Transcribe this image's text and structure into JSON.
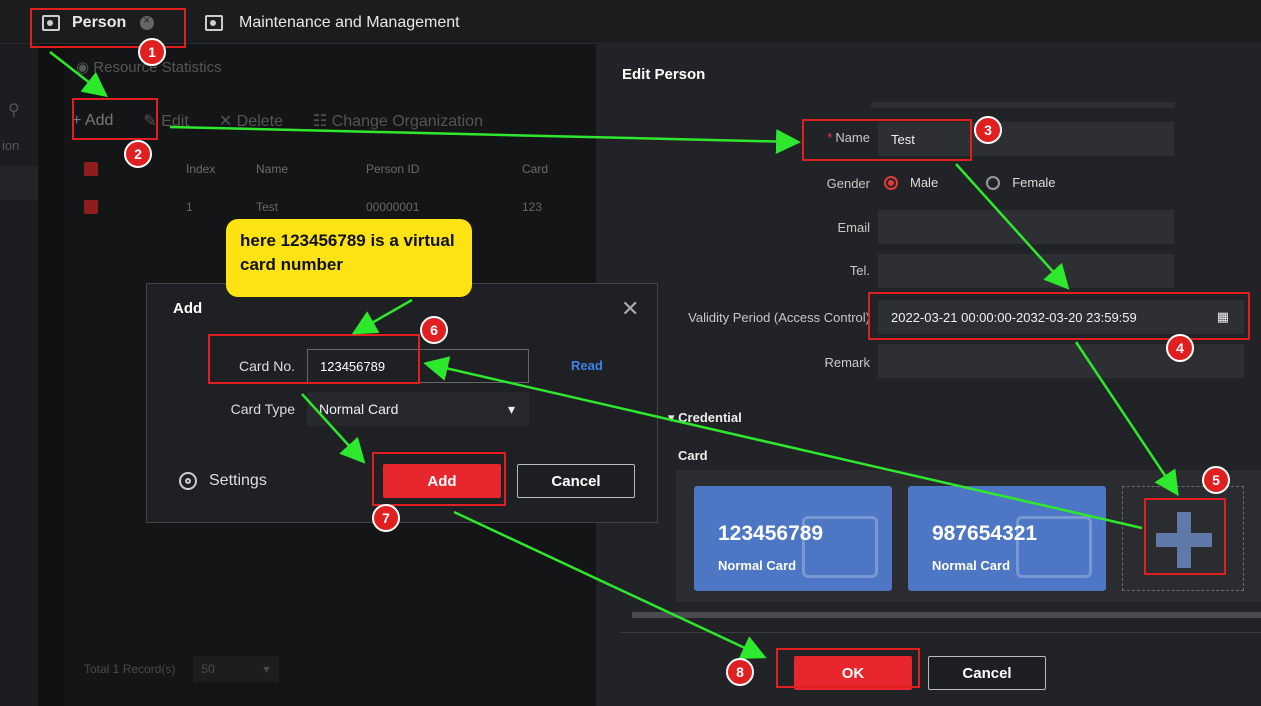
{
  "colors": {
    "accent": "#e8262d",
    "link": "#3d82e8",
    "card": "#4d76c4",
    "callout": "#fde314",
    "arrow": "#2ee82e"
  },
  "tabs": [
    {
      "label": "Person",
      "icon": "person-card-icon"
    },
    {
      "label": "Maintenance and Management",
      "icon": "clipboard-icon"
    }
  ],
  "main": {
    "resource_stats": "Resource Statistics",
    "toolbar": {
      "add": "Add",
      "edit": "Edit",
      "delete": "Delete",
      "change_org": "Change Organization"
    },
    "columns": [
      "Index",
      "Name",
      "Person ID",
      "Card"
    ],
    "rows": [
      {
        "index": "1",
        "name": "Test",
        "person_id": "00000001",
        "card": "123"
      }
    ],
    "footer": {
      "total": "Total 1 Record(s)",
      "page_size": "50"
    }
  },
  "edit_person": {
    "title": "Edit Person",
    "name_label": "Name",
    "name_value": "Test",
    "gender_label": "Gender",
    "gender_options": [
      "Male",
      "Female"
    ],
    "email_label": "Email",
    "tel_label": "Tel.",
    "validity_label": "Validity Period (Access Control)",
    "validity_value": "2022-03-21 00:00:00-2032-03-20 23:59:59",
    "remark_label": "Remark",
    "credential_label": "Credential",
    "card_label": "Card",
    "cards": [
      {
        "number": "123456789",
        "type": "Normal Card"
      },
      {
        "number": "987654321",
        "type": "Normal Card"
      }
    ],
    "ok": "OK",
    "cancel": "Cancel"
  },
  "add_dialog": {
    "title": "Add",
    "card_no_label": "Card No.",
    "card_no_value": "123456789",
    "read": "Read",
    "card_type_label": "Card Type",
    "card_type_value": "Normal Card",
    "settings": "Settings",
    "add": "Add",
    "cancel": "Cancel"
  },
  "callout": "here 123456789 is a virtual card number",
  "steps": [
    "1",
    "2",
    "3",
    "4",
    "5",
    "6",
    "7",
    "8"
  ]
}
